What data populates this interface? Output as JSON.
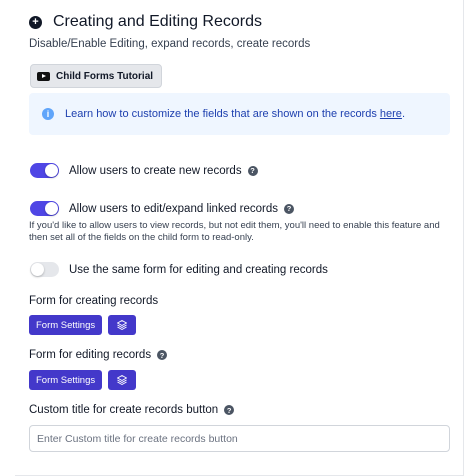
{
  "header": {
    "title": "Creating and Editing Records",
    "subtitle": "Disable/Enable Editing, expand records, create records"
  },
  "tutorial": {
    "label": "Child Forms Tutorial",
    "icon": "youtube-icon"
  },
  "info": {
    "text": "Learn how to customize the fields that are shown on the records ",
    "link_text": "here",
    "suffix": ".",
    "icon": "info-icon"
  },
  "toggles": [
    {
      "label": "Allow users to create new records",
      "enabled": true,
      "has_help": true
    },
    {
      "label": "Allow users to edit/expand linked records",
      "enabled": true,
      "has_help": true
    },
    {
      "label": "Use the same form for editing and creating records",
      "enabled": false,
      "has_help": false
    }
  ],
  "edit_note": "If you'd like to allow users to view records, but not edit them, you'll need to enable this feature and then set all of the fields on the child form to read-only.",
  "creating_form": {
    "label": "Form for creating records",
    "button": "Form Settings"
  },
  "editing_form": {
    "label": "Form for editing records",
    "button": "Form Settings"
  },
  "custom_title": {
    "label": "Custom title for create records button",
    "placeholder": "Enter Custom title for create records button",
    "value": ""
  },
  "colors": {
    "accent": "#4338ca",
    "toggle_on": "#4f46e5",
    "info_bg": "#eff6ff",
    "info_text": "#1e40af"
  }
}
